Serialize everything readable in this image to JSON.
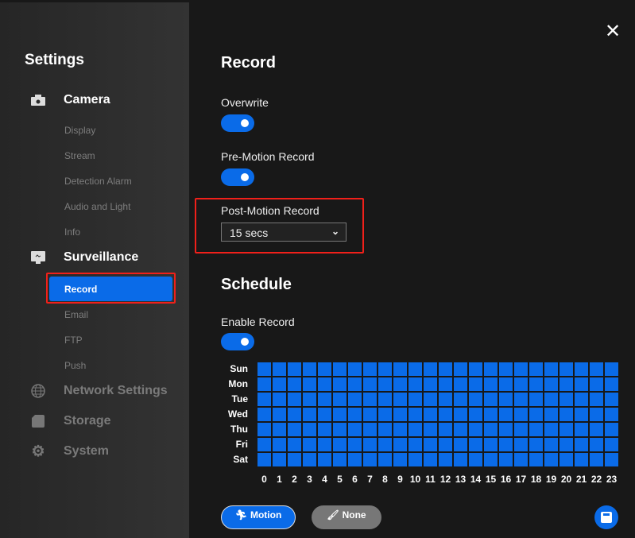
{
  "sidebar": {
    "title": "Settings",
    "groups": [
      {
        "label": "Camera",
        "icon": "camera-icon",
        "items": [
          "Display",
          "Stream",
          "Detection Alarm",
          "Audio and Light",
          "Info"
        ]
      },
      {
        "label": "Surveillance",
        "icon": "monitor-icon",
        "items": [
          "Record",
          "Email",
          "FTP",
          "Push"
        ],
        "selected": "Record"
      },
      {
        "label": "Network Settings",
        "icon": "globe-icon"
      },
      {
        "label": "Storage",
        "icon": "sd-card-icon"
      },
      {
        "label": "System",
        "icon": "gear-icon"
      }
    ]
  },
  "main": {
    "title": "Record",
    "overwrite": {
      "label": "Overwrite",
      "on": true
    },
    "pre_motion": {
      "label": "Pre-Motion Record",
      "on": true
    },
    "post_motion": {
      "label": "Post-Motion Record",
      "value": "15 secs"
    },
    "schedule": {
      "title": "Schedule",
      "enable": {
        "label": "Enable Record",
        "on": true
      },
      "days": [
        "Sun",
        "Mon",
        "Tue",
        "Wed",
        "Thu",
        "Fri",
        "Sat"
      ],
      "hours": [
        "0",
        "1",
        "2",
        "3",
        "4",
        "5",
        "6",
        "7",
        "8",
        "9",
        "10",
        "11",
        "12",
        "13",
        "14",
        "15",
        "16",
        "17",
        "18",
        "19",
        "20",
        "21",
        "22",
        "23"
      ],
      "all_cells": "motion"
    },
    "motion_button": "Motion",
    "none_button": "None"
  },
  "colors": {
    "accent": "#0a6be8",
    "highlight": "#f0201a"
  }
}
